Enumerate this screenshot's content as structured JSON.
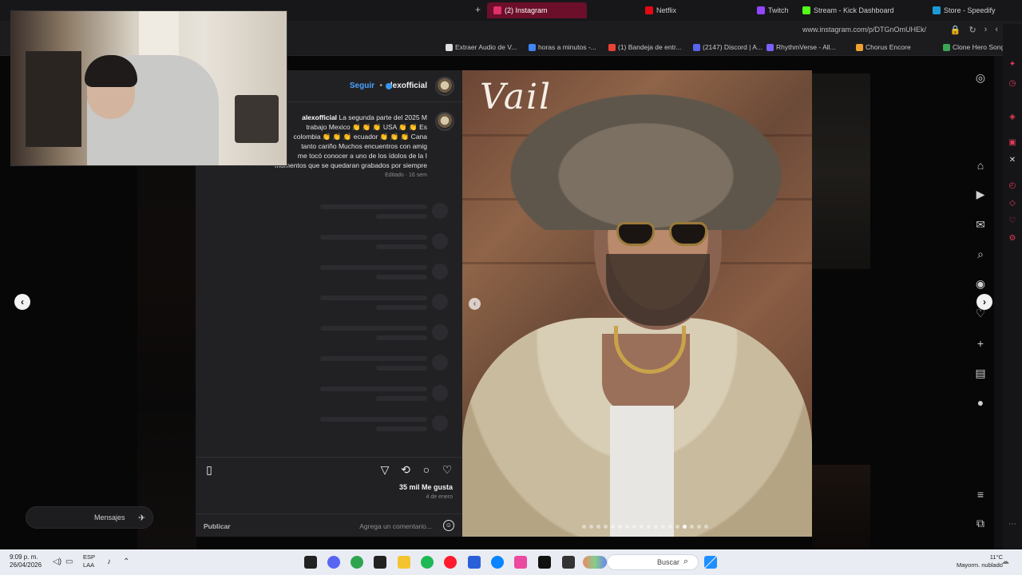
{
  "browser": {
    "tabs": [
      {
        "label": "Store - Speedify",
        "color": "#1a9bd7"
      },
      {
        "label": "Stream - Kick Dashboard",
        "color": "#53fc18"
      },
      {
        "label": "Twitch",
        "color": "#9146ff"
      },
      {
        "label": "Netflix",
        "color": "#e50914"
      },
      {
        "label": "(2) Instagram",
        "color": "#e1306c",
        "active": true
      }
    ],
    "new_tab": "+",
    "url": "www.instagram.com/p/DTGnOmUHEk/",
    "bookmarks": [
      {
        "label": "Clone Hero Songs...",
        "color": "#3aa655"
      },
      {
        "label": "Chorus Encore",
        "color": "#f0a030"
      },
      {
        "label": "RhythmVerse - All...",
        "color": "#7b61ff"
      },
      {
        "label": "(2147) Discord | A...",
        "color": "#5865f2"
      },
      {
        "label": "(1) Bandeja de entr...",
        "color": "#ea4335"
      },
      {
        "label": "horas a minutos -...",
        "color": "#4285f4"
      },
      {
        "label": "Extraer Audio de V...",
        "color": "#e0e0e0"
      }
    ]
  },
  "post": {
    "username": "alexofficial",
    "follow": "Seguir",
    "separator": "•",
    "caption_user": "alexofficial",
    "caption_lines": [
      "La segunda parte del 2025 M",
      "trabajo Mexico 👏 👏 👏 USA 👏 👏 Es",
      "colombia 👏 👏 👏 ecuador 👏 👏 👏 Cana",
      "tanto cariño Muchos encuentros con amig",
      "me tocó conocer a uno de los ídolos de la I",
      "momentos que se quedaran grabados por siempre"
    ],
    "caption_meta": "Editado · 16 sem",
    "likes": "35 mil Me gusta",
    "date": "4 de enero",
    "add_comment_placeholder": "Agrega un comentario...",
    "publish": "Publicar",
    "image_title": "Vail"
  },
  "navigation": {
    "prev": "‹",
    "next": "›"
  },
  "messages": {
    "label": "Mensajes"
  },
  "taskbar": {
    "search_label": "Buscar",
    "time": "9:09 p. m.",
    "date": "26/04/2026",
    "lang1": "ESP",
    "lang2": "LAA",
    "weather_temp": "11°C",
    "weather_desc": "Mayorm. nublado"
  },
  "colors": {
    "accent": "#e1306c",
    "verified": "#3897f0",
    "follow": "#4aa3ff"
  }
}
